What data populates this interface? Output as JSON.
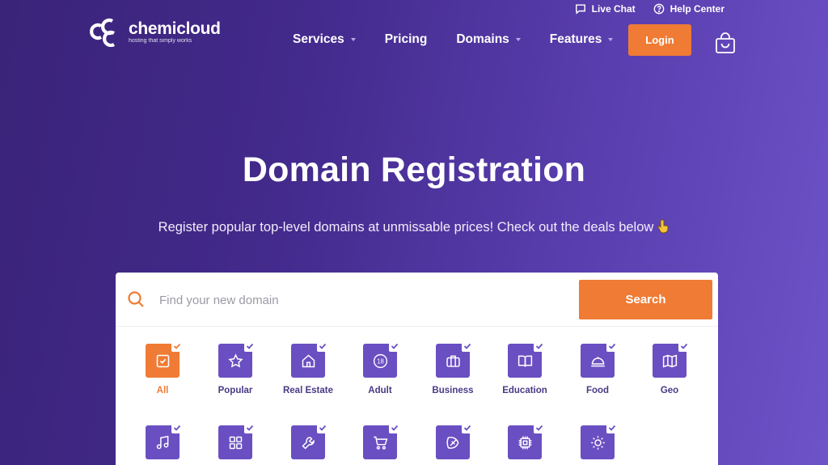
{
  "topbar": {
    "live_chat": "Live Chat",
    "help_center": "Help Center"
  },
  "logo": {
    "name": "chemicloud",
    "tagline": "hosting that simply works"
  },
  "nav": {
    "services": "Services",
    "pricing": "Pricing",
    "domains": "Domains",
    "features": "Features",
    "login": "Login"
  },
  "hero": {
    "title": "Domain Registration",
    "subtitle": "Register popular top-level domains at unmissable prices! Check out the deals below"
  },
  "search": {
    "placeholder": "Find your new domain",
    "button": "Search"
  },
  "categories": [
    {
      "label": "All",
      "icon": "checkbox-icon",
      "active": true
    },
    {
      "label": "Popular",
      "icon": "star-icon"
    },
    {
      "label": "Real Estate",
      "icon": "house-icon"
    },
    {
      "label": "Adult",
      "icon": "eighteen-icon"
    },
    {
      "label": "Business",
      "icon": "briefcase-icon"
    },
    {
      "label": "Education",
      "icon": "book-icon"
    },
    {
      "label": "Food",
      "icon": "cloche-icon"
    },
    {
      "label": "Geo",
      "icon": "map-icon"
    },
    {
      "label": "",
      "icon": "music-icon"
    },
    {
      "label": "",
      "icon": "grid-icon"
    },
    {
      "label": "",
      "icon": "wrench-icon"
    },
    {
      "label": "",
      "icon": "cart-icon"
    },
    {
      "label": "",
      "icon": "tag-icon"
    },
    {
      "label": "",
      "icon": "chip-icon"
    },
    {
      "label": "",
      "icon": "sun-icon"
    }
  ],
  "colors": {
    "accent": "#ef7b35",
    "tile": "#6a4fc2",
    "background_start": "#3a2379",
    "background_end": "#6e52c8"
  }
}
